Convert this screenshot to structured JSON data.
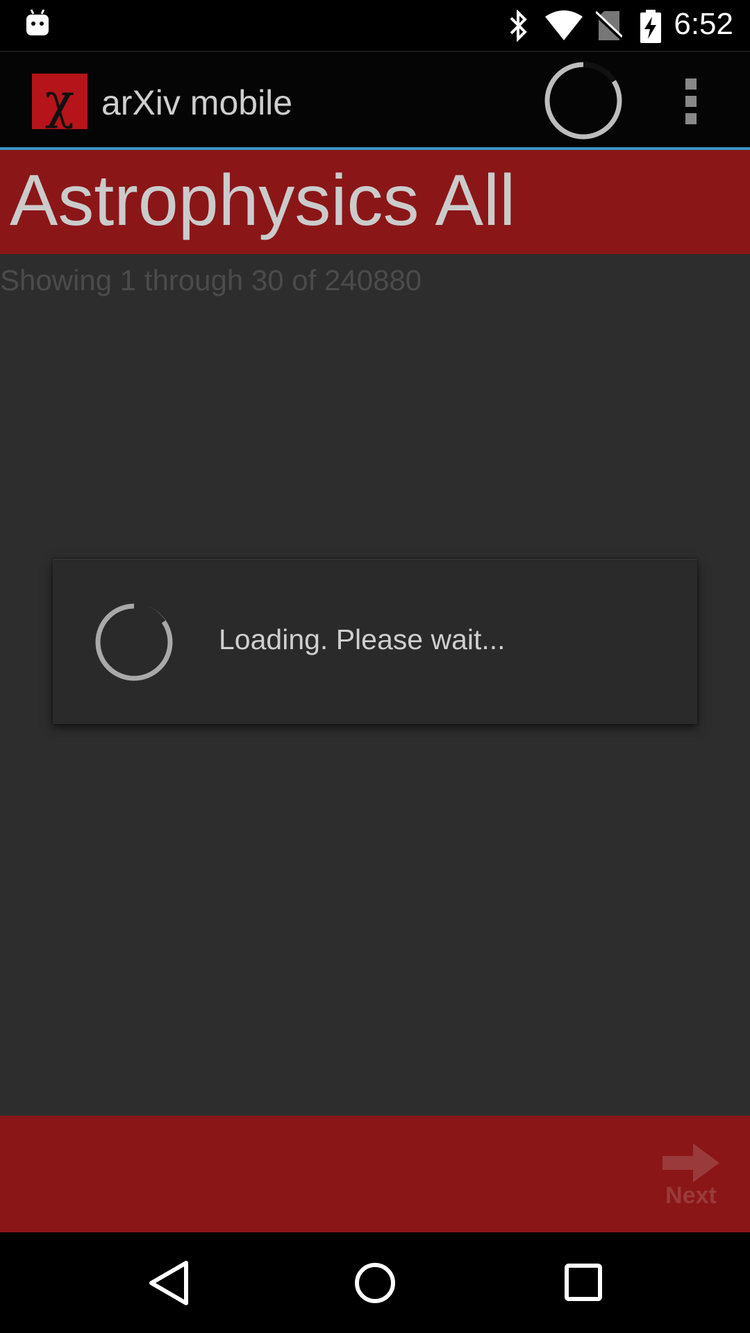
{
  "status_bar": {
    "time": "6:52",
    "icons": [
      "android-icon",
      "bluetooth-icon",
      "wifi-icon",
      "no-sim-icon",
      "battery-charging-icon"
    ]
  },
  "action_bar": {
    "app_title": "arXiv mobile",
    "logo_glyph": "χ",
    "logo_color": "#b5141a",
    "accent_color": "#3a93c2",
    "icons": [
      "progress-spinner-icon",
      "overflow-menu-icon"
    ]
  },
  "category": {
    "title": "Astrophysics All",
    "banner_color": "#8b1618"
  },
  "results": {
    "summary": "Showing 1 through 30 of 240880"
  },
  "dialog": {
    "message": "Loading. Please wait..."
  },
  "bottom_bar": {
    "next_label": "Next",
    "color": "#8b1618"
  },
  "nav_bar": {
    "icons": [
      "back-icon",
      "home-icon",
      "recents-icon"
    ]
  }
}
